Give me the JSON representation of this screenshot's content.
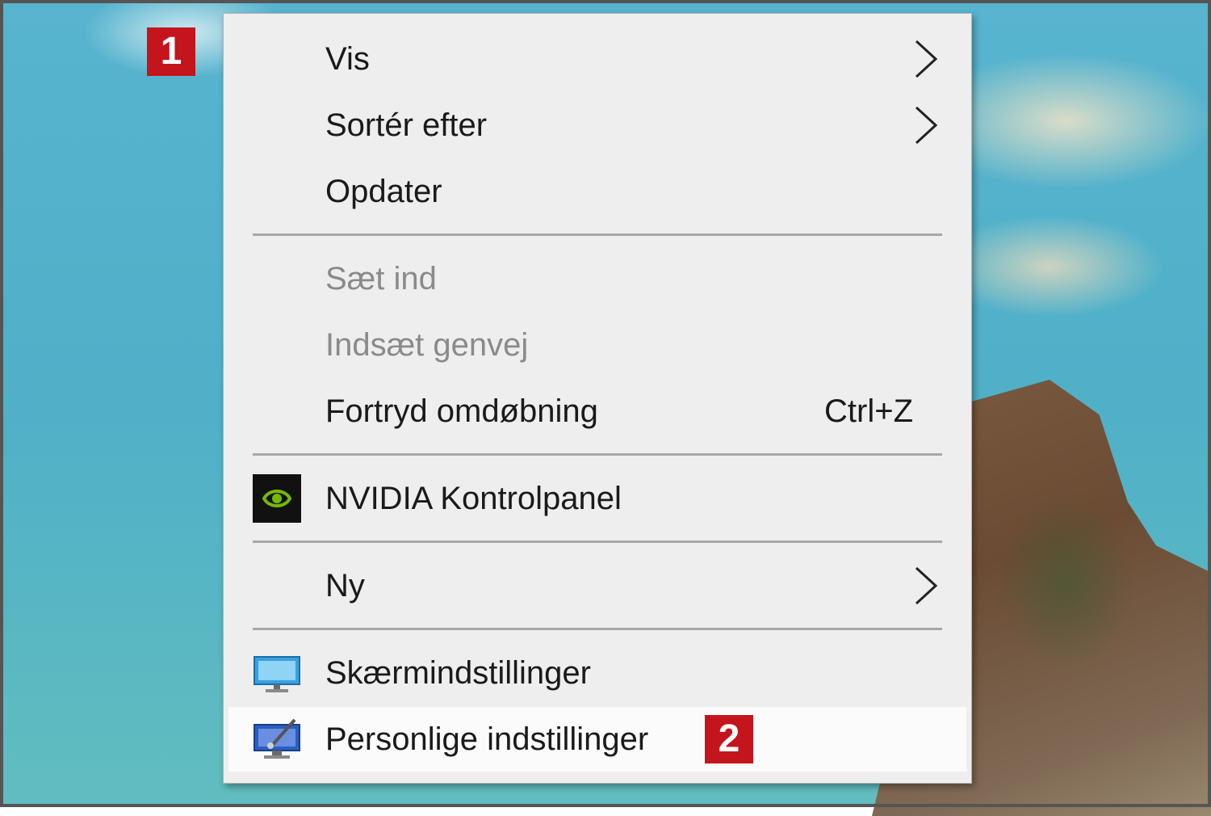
{
  "badges": {
    "step1": "1",
    "step2": "2"
  },
  "menu": {
    "items": {
      "vis": {
        "label": "Vis",
        "icon": "chevron-right-icon"
      },
      "sortér": {
        "label": "Sortér efter",
        "icon": "chevron-right-icon"
      },
      "opdater": {
        "label": "Opdater"
      },
      "saet_ind": {
        "label": "Sæt ind",
        "disabled": true
      },
      "indsaet_genvej": {
        "label": "Indsæt genvej",
        "disabled": true
      },
      "fortryd": {
        "label": "Fortryd omdøbning",
        "shortcut": "Ctrl+Z"
      },
      "nvidia": {
        "label": "NVIDIA Kontrolpanel",
        "icon": "nvidia-icon"
      },
      "ny": {
        "label": "Ny",
        "icon": "chevron-right-icon"
      },
      "skaerm": {
        "label": "Skærmindstillinger",
        "icon": "display-icon"
      },
      "personlige": {
        "label": "Personlige indstillinger",
        "icon": "personalize-icon",
        "highlighted": true
      }
    }
  },
  "colors": {
    "badge": "#c4151c",
    "menu_bg": "#eeeeee",
    "highlight_bg": "#fbfbfb",
    "disabled_text": "#8a8a8a",
    "nvidia_green": "#76b900"
  }
}
